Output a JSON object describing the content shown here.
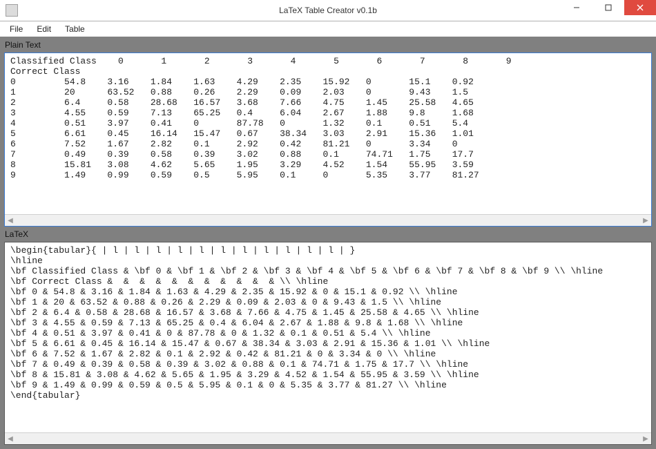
{
  "window": {
    "title": "LaTeX Table Creator v0.1b"
  },
  "menu": {
    "file": "File",
    "edit": "Edit",
    "table": "Table"
  },
  "panes": {
    "plain_label": "Plain Text",
    "latex_label": "LaTeX"
  },
  "table": {
    "header_label": "Classified Class",
    "subheader_label": "Correct Class",
    "col_labels": [
      "0",
      "1",
      "2",
      "3",
      "4",
      "5",
      "6",
      "7",
      "8",
      "9"
    ],
    "rows": [
      {
        "label": "0",
        "cells": [
          "54.8",
          "3.16",
          "1.84",
          "1.63",
          "4.29",
          "2.35",
          "15.92",
          "0",
          "15.1",
          "0.92"
        ]
      },
      {
        "label": "1",
        "cells": [
          "20",
          "63.52",
          "0.88",
          "0.26",
          "2.29",
          "0.09",
          "2.03",
          "0",
          "9.43",
          "1.5"
        ]
      },
      {
        "label": "2",
        "cells": [
          "6.4",
          "0.58",
          "28.68",
          "16.57",
          "3.68",
          "7.66",
          "4.75",
          "1.45",
          "25.58",
          "4.65"
        ]
      },
      {
        "label": "3",
        "cells": [
          "4.55",
          "0.59",
          "7.13",
          "65.25",
          "0.4",
          "6.04",
          "2.67",
          "1.88",
          "9.8",
          "1.68"
        ]
      },
      {
        "label": "4",
        "cells": [
          "0.51",
          "3.97",
          "0.41",
          "0",
          "87.78",
          "0",
          "1.32",
          "0.1",
          "0.51",
          "5.4"
        ]
      },
      {
        "label": "5",
        "cells": [
          "6.61",
          "0.45",
          "16.14",
          "15.47",
          "0.67",
          "38.34",
          "3.03",
          "2.91",
          "15.36",
          "1.01"
        ]
      },
      {
        "label": "6",
        "cells": [
          "7.52",
          "1.67",
          "2.82",
          "0.1",
          "2.92",
          "0.42",
          "81.21",
          "0",
          "3.34",
          "0"
        ]
      },
      {
        "label": "7",
        "cells": [
          "0.49",
          "0.39",
          "0.58",
          "0.39",
          "3.02",
          "0.88",
          "0.1",
          "74.71",
          "1.75",
          "17.7"
        ]
      },
      {
        "label": "8",
        "cells": [
          "15.81",
          "3.08",
          "4.62",
          "5.65",
          "1.95",
          "3.29",
          "4.52",
          "1.54",
          "55.95",
          "3.59"
        ]
      },
      {
        "label": "9",
        "cells": [
          "1.49",
          "0.99",
          "0.59",
          "0.5",
          "5.95",
          "0.1",
          "0",
          "5.35",
          "3.77",
          "81.27"
        ]
      }
    ]
  },
  "latex": {
    "begin": "\\begin{tabular}{ | l | l | l | l | l | l | l | l | l | l | l | }",
    "end": "\\end{tabular}",
    "hline": "\\hline"
  }
}
